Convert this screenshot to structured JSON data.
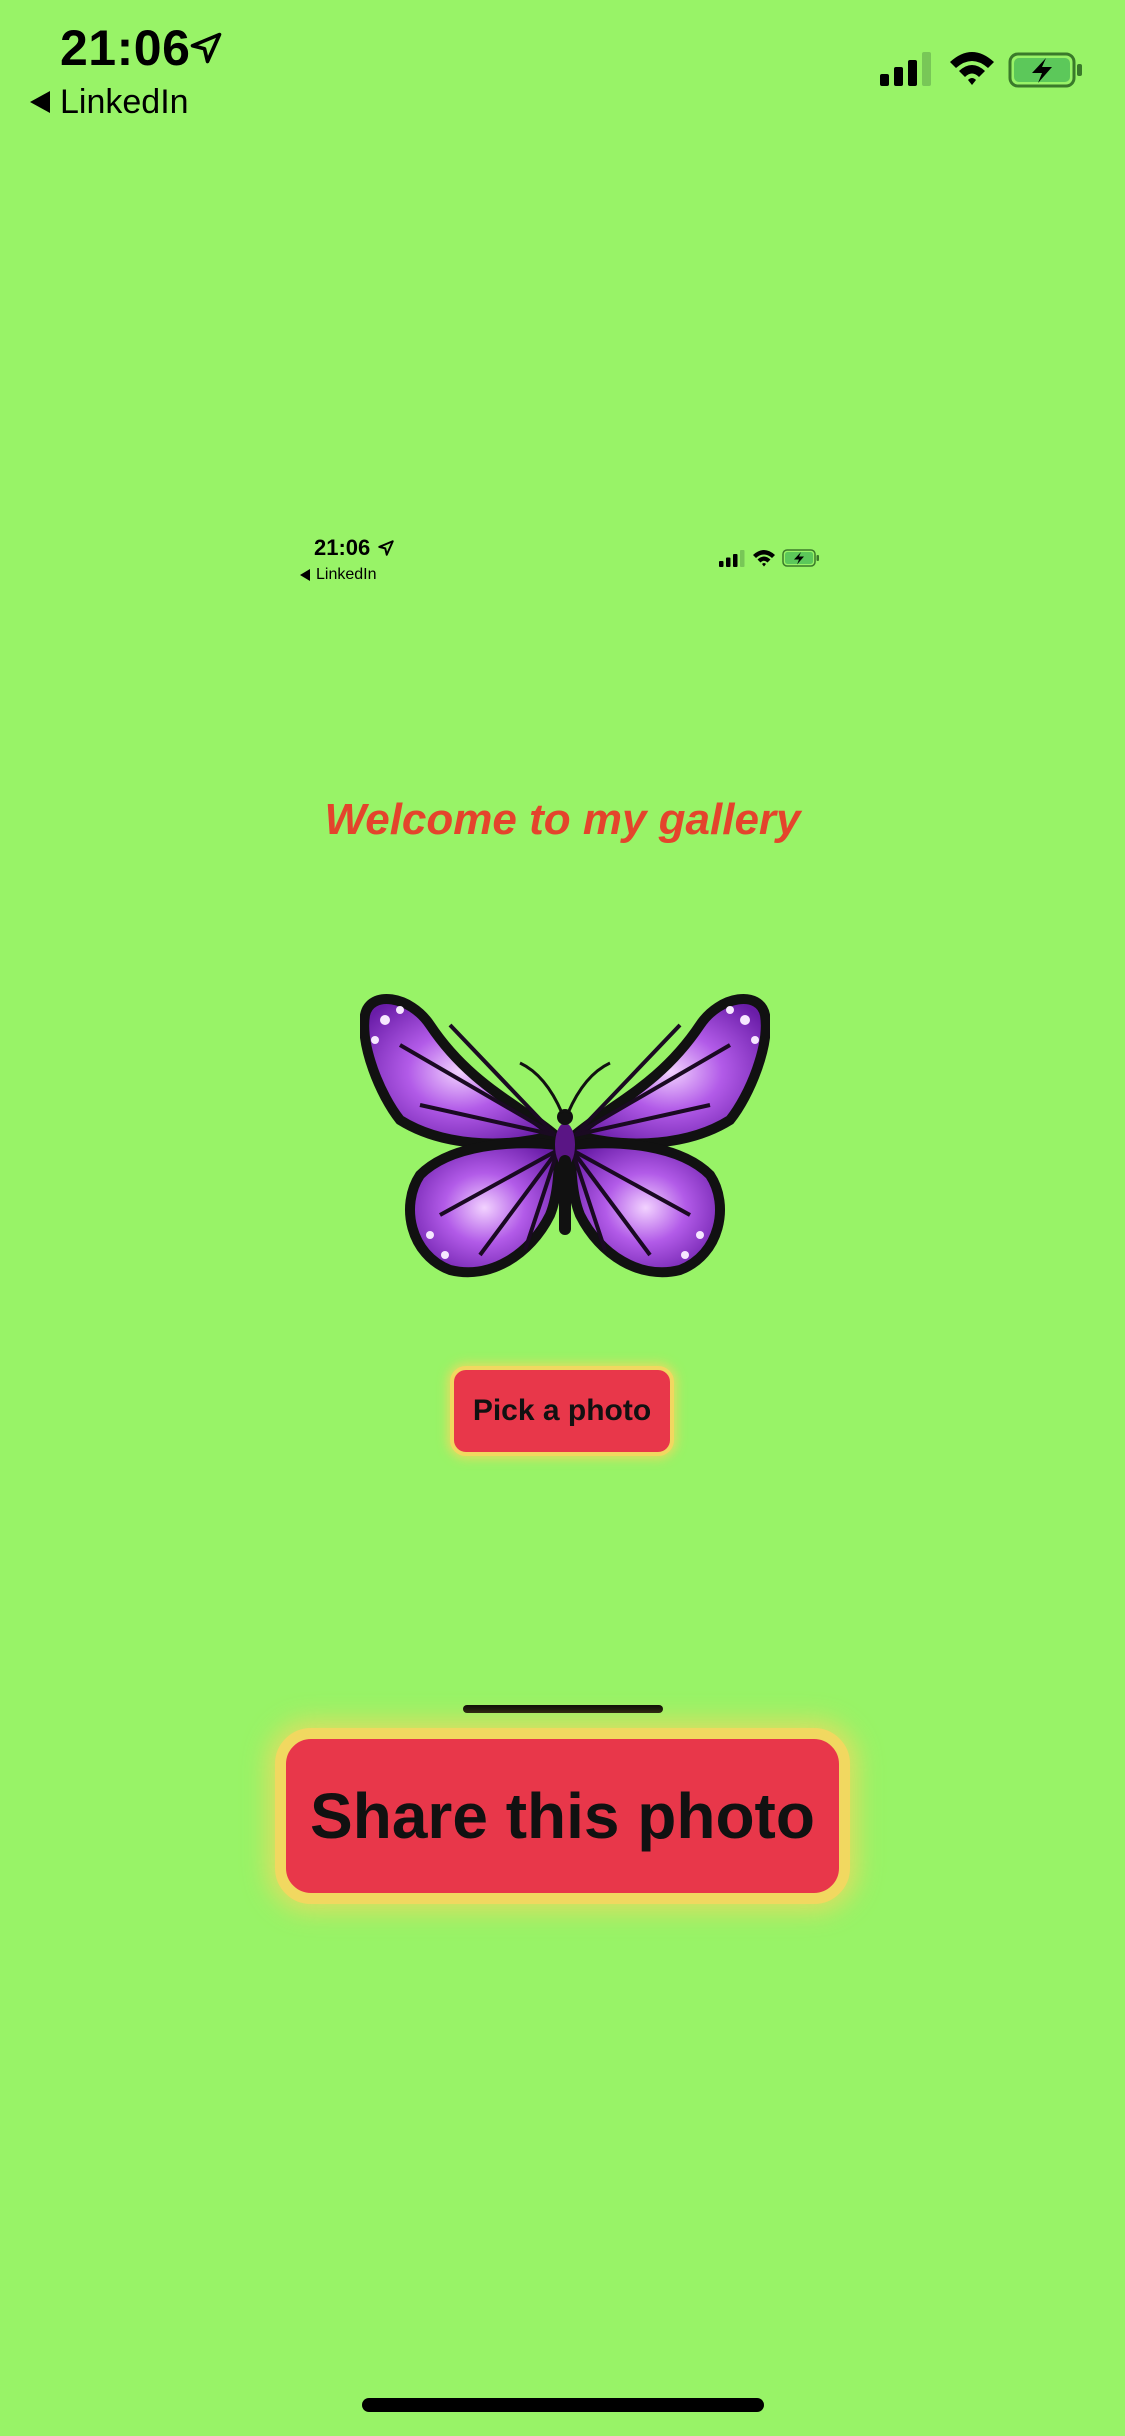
{
  "status_bar": {
    "time": "21:06",
    "back_label": "LinkedIn",
    "icons": [
      "location-arrow-icon",
      "cellular-signal-icon",
      "wifi-icon",
      "battery-charging-icon"
    ]
  },
  "embedded_screenshot": {
    "time": "21:06",
    "back_label": "LinkedIn"
  },
  "gallery": {
    "title": "Welcome to my gallery",
    "image_subject": "purple butterfly",
    "pick_button": "Pick a photo",
    "share_button": "Share this photo"
  },
  "colors": {
    "background": "#98f367",
    "title": "#e4442c",
    "button_fill": "#e8374a",
    "button_border": "#f1d860",
    "battery_fill": "#5cc85a"
  }
}
